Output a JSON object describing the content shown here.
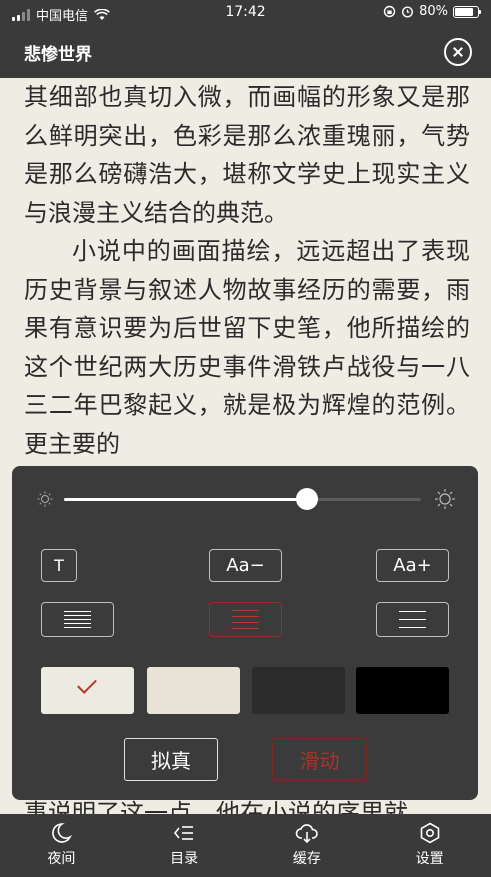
{
  "status_bar": {
    "carrier": "中国电信",
    "time": "17:42",
    "battery": "80%",
    "battery_level": 0.8
  },
  "header": {
    "title": "悲惨世界"
  },
  "reader": {
    "paragraphs": [
      "其细部也真切入微，而画幅的形象又是那么鲜明突出，色彩是那么浓重瑰丽，气势是那么磅礴浩大，堪称文学史上现实主义与浪漫主义结合的典范。",
      "小说中的画面描绘，远远超出了表现历史背景与叙述人物故事经历的需要，雨果有意识要为后世留下史笔，他所描绘的这个世纪两大历史事件滑铁卢战役与一八三二年巴黎起义，就是极为辉煌的范例。更主要的",
      "事说明了这一点，他在小说的序里就"
    ]
  },
  "settings": {
    "brightness": 0.68,
    "font_toggle_label": "T",
    "font_smaller_label": "Aa−",
    "font_larger_label": "Aa+",
    "line_spacing_selected": "medium",
    "colors": [
      "#edeae2",
      "#e9e3d7",
      "#2b2b2b",
      "#000000"
    ],
    "accent": "#b3392b",
    "page_mode_realistic": "拟真",
    "page_mode_scroll": "滑动",
    "page_mode_selected": "滑动"
  },
  "tabbar": {
    "items": [
      {
        "label": "夜间",
        "icon": "moon-icon"
      },
      {
        "label": "目录",
        "icon": "list-icon"
      },
      {
        "label": "缓存",
        "icon": "cloud-download-icon"
      },
      {
        "label": "设置",
        "icon": "gear-icon"
      }
    ]
  }
}
